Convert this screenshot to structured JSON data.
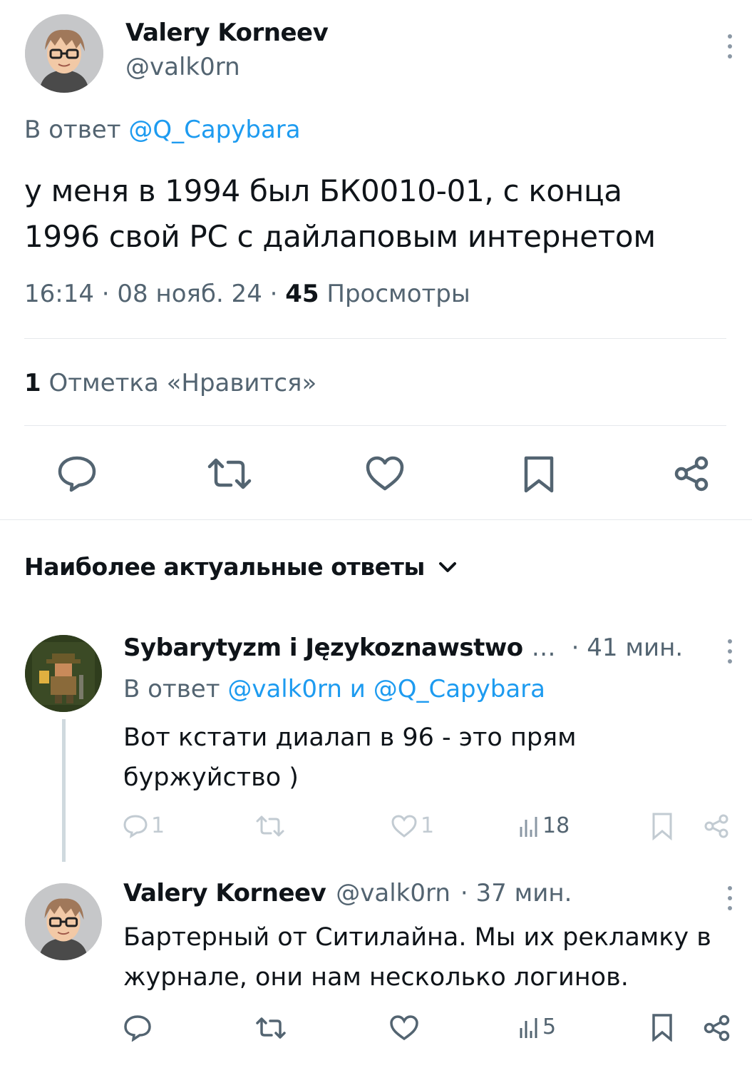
{
  "main_tweet": {
    "author_name": "Valery Korneev",
    "author_handle": "@valk0rn",
    "reply_prefix": "В ответ",
    "reply_to": "@Q_Capybara",
    "text_line1": "у меня в 1994 был БК0010-01, с конца",
    "text_line2": "1996 свой PC с дайлаповым интернетом",
    "time": "16:14",
    "date": "08 нояб. 24",
    "sep": "·",
    "views_count": "45",
    "views_label": "Просмотры",
    "likes_count": "1",
    "likes_label": "Отметка «Нравится»"
  },
  "replies_header": {
    "label": "Наиболее актуальные ответы"
  },
  "reply1": {
    "author_name": "Sybarytyzm i Językoznawstwo",
    "ellipsis": "…",
    "time": "· 41 мин.",
    "reply_prefix": "В ответ",
    "reply_to_1": "@valk0rn",
    "and": "и",
    "reply_to_2": "@Q_Capybara",
    "text_line1": "Вот кстати диалап в 96 - это прям",
    "text_line2": "буржуйство )",
    "replies": "1",
    "likes": "1",
    "views": "18"
  },
  "reply2": {
    "author_name": "Valery Korneev",
    "author_handle": "@valk0rn",
    "time": "· 37 мин.",
    "text_line1": "Бартерный от Ситилайна. Мы их рекламку в",
    "text_line2": "журнале, они нам несколько логинов.",
    "views": "5"
  },
  "colors": {
    "link": "#1d9bf0",
    "muted": "#536471",
    "text": "#0f1419"
  }
}
